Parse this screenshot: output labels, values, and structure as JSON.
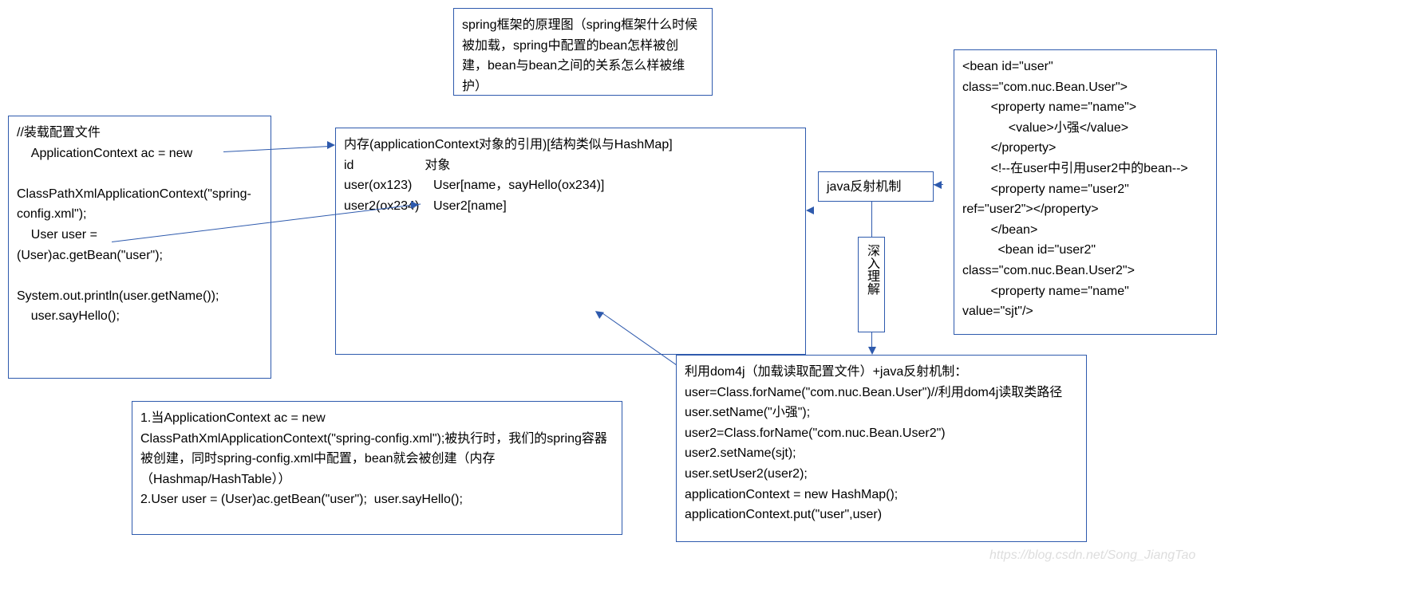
{
  "title_box": "spring框架的原理图（spring框架什么时候被加载，spring中配置的bean怎样被创建，bean与bean之间的关系怎么样被维护）",
  "left_code_box": "//装载配置文件\n    ApplicationContext ac = new\n\nClassPathXmlApplicationContext(\"spring-config.xml\");\n    User user =\n(User)ac.getBean(\"user\");\n\nSystem.out.println(user.getName());\n    user.sayHello();",
  "memory_box": "内存(applicationContext对象的引用)[结构类似与HashMap]\nid                    对象\nuser(ox123)      User[name，sayHello(ox234)]\nuser2(ox234)    User2[name]",
  "reflect_label_box": "java反射机制",
  "vertical_label": "深入理解",
  "xml_box": "<bean id=\"user\"\nclass=\"com.nuc.Bean.User\">\n        <property name=\"name\">\n             <value>小强</value>\n        </property>\n        <!--在user中引用user2中的bean-->\n        <property name=\"user2\"\nref=\"user2\"></property>\n        </bean>\n          <bean id=\"user2\"\nclass=\"com.nuc.Bean.User2\">\n        <property name=\"name\"\nvalue=\"sjt\"/>",
  "explain_box": "1.当ApplicationContext ac = new\nClassPathXmlApplicationContext(\"spring-config.xml\");被执行时，我们的spring容器被创建，同时spring-config.xml中配置，bean就会被创建（内存（Hashmap/HashTable））\n2.User user = (User)ac.getBean(\"user\");  user.sayHello();",
  "dom4j_box": "利用dom4j（加载读取配置文件）+java反射机制：\nuser=Class.forName(\"com.nuc.Bean.User\")//利用dom4j读取类路径\nuser.setName(\"小强\");\nuser2=Class.forName(\"com.nuc.Bean.User2\")\nuser2.setName(sjt);\nuser.setUser2(user2);\napplicationContext = new HashMap();\napplicationContext.put(\"user\",user)",
  "watermark": "https://blog.csdn.net/Song_JiangTao"
}
